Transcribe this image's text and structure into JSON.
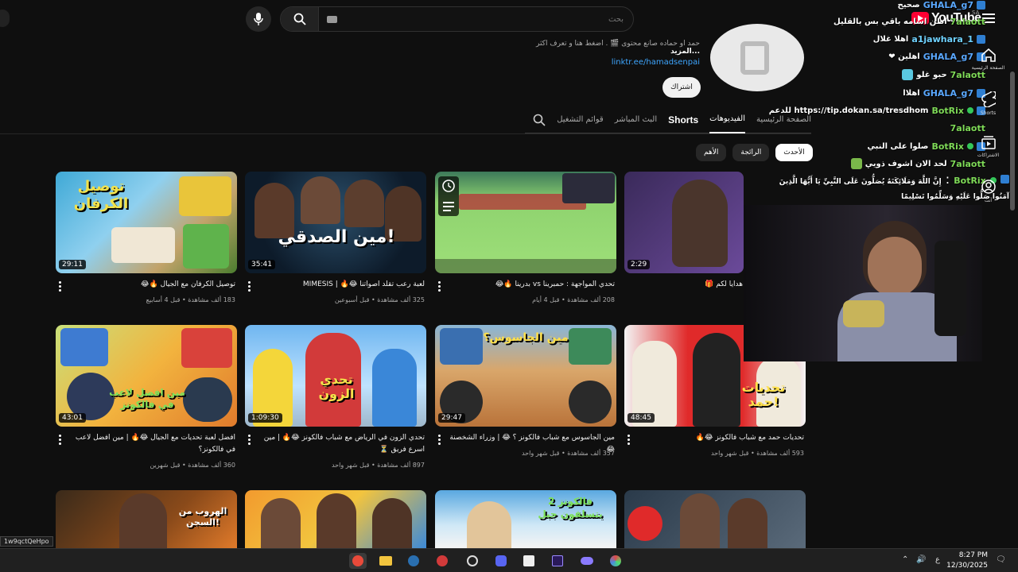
{
  "search": {
    "placeholder": "بحث"
  },
  "brand": {
    "logo": "YouTube",
    "region": "SA"
  },
  "channel": {
    "description": "حمد او حماده صانع محتوى 🎬 . اضغط هنا و تعرف اكثر",
    "more": "...المزيد",
    "link": "linktr.ee/hamadsenpai",
    "subscribe": "اشتراك"
  },
  "tabs": [
    {
      "label": "الصفحة الرئيسية"
    },
    {
      "label": "الفيديوهات"
    },
    {
      "label": "Shorts"
    },
    {
      "label": "البث المباشر"
    },
    {
      "label": "قوائم التشغيل"
    }
  ],
  "chips": [
    {
      "label": "الأهم"
    },
    {
      "label": "الرائجة"
    },
    {
      "label": "الأحدث"
    }
  ],
  "videos": [
    {
      "title": "توصيل الكرفان مع الجيال 🔥😂",
      "views": "183 ألف مشاهدة",
      "age": "قبل 4 أسابيع",
      "duration": "29:11",
      "thumb_text": "توصيل الكرفان"
    },
    {
      "title": "لعبة رعب تقلد اصواتنا 😂🔥 | MIMESIS",
      "views": "325 ألف مشاهدة",
      "age": "قبل أسبوعين",
      "duration": "35:41",
      "thumb_text": "مين الصدقي!"
    },
    {
      "title": "تحدي المواجهة : حمبرينا vs بدرينا 🔥😂",
      "views": "208 ألف مشاهدة",
      "age": "قبل 4 أيام",
      "duration": "",
      "thumb_text": ""
    },
    {
      "title": "هدايا لكم 🎁",
      "views": "",
      "age": "",
      "duration": "2:29",
      "thumb_text": ""
    },
    {
      "title": "افضل لعبة تحديات مع الجيال 😂🔥 | مين افضل لاعب في فالكونز؟",
      "views": "360 ألف مشاهدة",
      "age": "قبل شهرين",
      "duration": "43:01",
      "thumb_text": "مين افضل لاعب في فالكونز"
    },
    {
      "title": "تحدي الزون في الرياض مع شباب فالكونز 😂🔥 | مين اسرع فريق ⏳",
      "views": "897 ألف مشاهدة",
      "age": "قبل شهر واحد",
      "duration": "1:09:30",
      "thumb_text": "تحدي الزون"
    },
    {
      "title": "مين الجاسوس مع شباب فالكونز ؟ 😂 | وزراء الشخصنة 😂",
      "views": "357 ألف مشاهدة",
      "age": "قبل شهر واحد",
      "duration": "29:47",
      "thumb_text": "مين الجاسوس؟"
    },
    {
      "title": "تحديات حمد مع شباب فالكونز 😂🔥",
      "views": "593 ألف مشاهدة",
      "age": "قبل شهر واحد",
      "duration": "48:45",
      "thumb_text": "تحديات حمد!"
    },
    {
      "title": "",
      "views": "",
      "age": "",
      "duration": "",
      "thumb_text": "الهروب من السجن!"
    },
    {
      "title": "",
      "views": "",
      "age": "",
      "duration": "",
      "thumb_text": ""
    },
    {
      "title": "",
      "views": "",
      "age": "",
      "duration": "",
      "thumb_text": "فالكونز 2 يتسلقون جبل"
    },
    {
      "title": "",
      "views": "",
      "age": "",
      "duration": "",
      "thumb_text": ""
    }
  ],
  "chat": [
    {
      "user": "GHALA_g7",
      "msg": "صحيح"
    },
    {
      "user": "7alaott",
      "msg": "اظن اسامه باقي بس بالقليل"
    },
    {
      "user": "a1jawhara_1",
      "msg": "اهلا غلال"
    },
    {
      "user": "GHALA_g7",
      "msg": "❤ اهلين"
    },
    {
      "user": "7alaott",
      "msg": "حبو غلو"
    },
    {
      "user": "GHALA_g7",
      "msg": "اهلاا"
    },
    {
      "user": "BotRix",
      "msg": "للدعم https://tip.dokan.sa/tresdhom"
    },
    {
      "user": "7alaott",
      "msg": ""
    },
    {
      "user": "BotRix",
      "msg": "صلوا على النبي"
    },
    {
      "user": "7alaott",
      "msg": "لحد الان اشوف ذويي"
    },
    {
      "user": "BotRix",
      "msg": "إِنَّ اللَّهَ وَمَلَائِكَتَهُ يُصَلُّونَ عَلَى النَّبِيِّ يَا أَيُّهَا الَّذِينَ آمَنُوا صَلُّوا عَلَيْهِ وَسَلِّمُوا تَسْلِيمًا"
    }
  ],
  "rail": [
    {
      "label": "الصفحة الرئيسية"
    },
    {
      "label": "Shorts"
    },
    {
      "label": "الاشتراكات"
    },
    {
      "label": "أنت"
    }
  ],
  "taskbar": {
    "time": "8:27 PM",
    "date": "12/30/2025",
    "lang": "ع"
  },
  "url_hint": "1w9qctQeHpo"
}
